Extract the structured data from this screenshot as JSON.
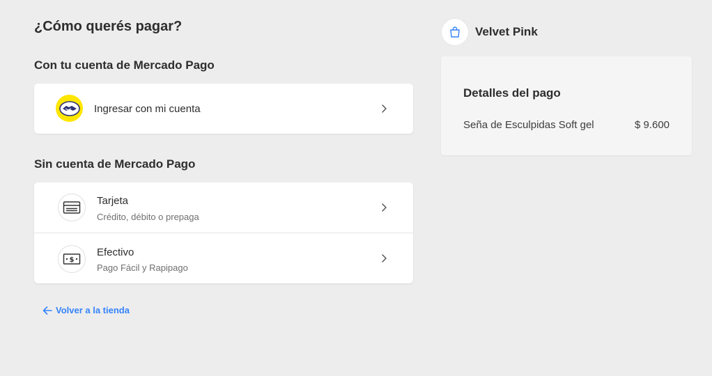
{
  "main": {
    "title": "¿Cómo querés pagar?",
    "with_account": {
      "title": "Con tu cuenta de Mercado Pago",
      "login_label": "Ingresar con mi cuenta"
    },
    "without_account": {
      "title": "Sin cuenta de Mercado Pago",
      "options": [
        {
          "label": "Tarjeta",
          "sub": "Crédito, débito o prepaga",
          "icon": "credit-card-icon"
        },
        {
          "label": "Efectivo",
          "sub": "Pago Fácil y Rapipago",
          "icon": "cash-icon"
        }
      ]
    },
    "back_link": "Volver a la tienda"
  },
  "sidebar": {
    "store_name": "Velvet Pink",
    "summary_title": "Detalles del pago",
    "item_name": "Seña de Esculpidas Soft gel",
    "item_price": "$ 9.600"
  },
  "colors": {
    "accent": "#3483fa",
    "mp_yellow": "#ffe600",
    "background": "#ededed"
  }
}
